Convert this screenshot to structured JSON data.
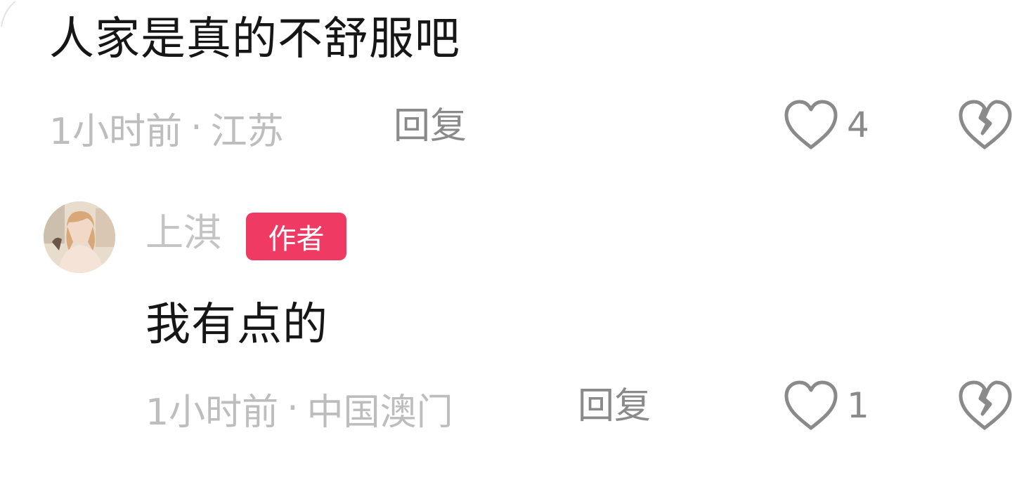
{
  "colors": {
    "text_primary": "#161616",
    "text_meta": "#bdbdbd",
    "text_action": "#8a8a8a",
    "badge_bg": "#ef3b64",
    "badge_text": "#ffffff"
  },
  "comment_1": {
    "text": "人家是真的不舒服吧",
    "time": "1小时前",
    "separator": "·",
    "location": "江苏",
    "reply_label": "回复",
    "like_icon": "heart-outline-icon",
    "like_count": "4",
    "dislike_icon": "broken-heart-icon"
  },
  "reply_1": {
    "avatar_icon": "user-avatar-photo",
    "username": "上淇",
    "badge": "作者",
    "text": "我有点的",
    "time": "1小时前",
    "separator": "·",
    "location": "中国澳门",
    "reply_label": "回复",
    "like_icon": "heart-outline-icon",
    "like_count": "1",
    "dislike_icon": "broken-heart-icon"
  }
}
